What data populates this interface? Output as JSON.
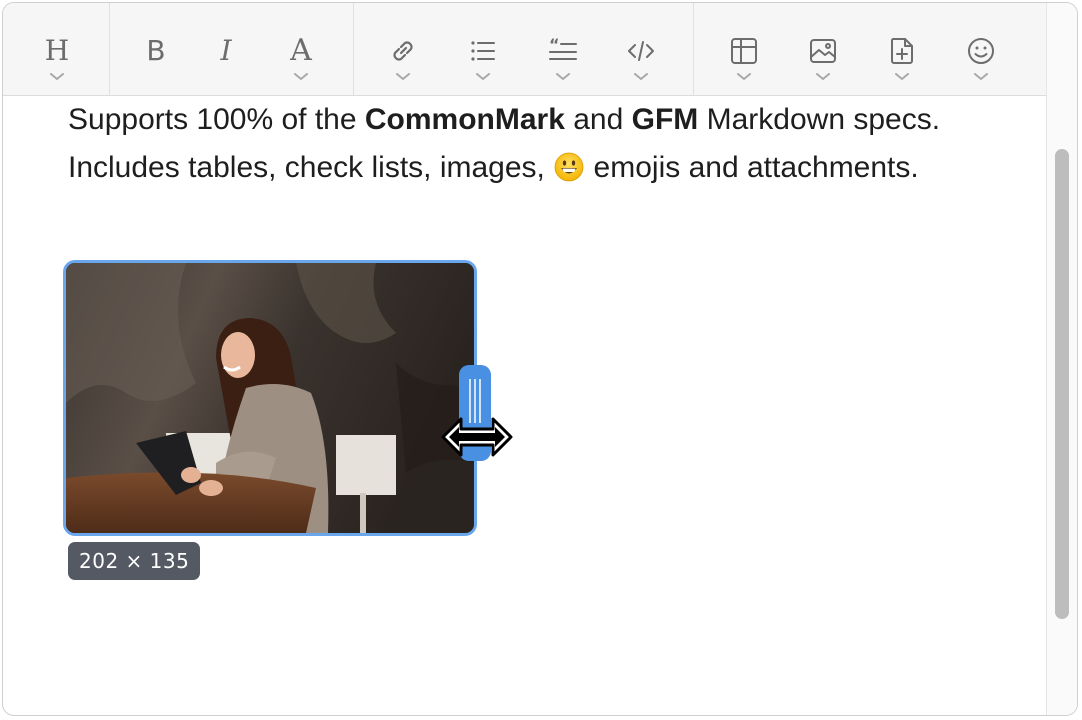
{
  "toolbar": {
    "tools": [
      {
        "name": "heading",
        "icon": "heading-icon",
        "has_menu": true
      },
      {
        "name": "bold",
        "icon": "bold-icon",
        "has_menu": false
      },
      {
        "name": "italic",
        "icon": "italic-icon",
        "has_menu": false
      },
      {
        "name": "font",
        "icon": "font-style-icon",
        "has_menu": true
      },
      {
        "name": "link",
        "icon": "link-icon",
        "has_menu": true
      },
      {
        "name": "list",
        "icon": "list-icon",
        "has_menu": true
      },
      {
        "name": "quote",
        "icon": "quote-icon",
        "has_menu": true
      },
      {
        "name": "code",
        "icon": "code-icon",
        "has_menu": true
      },
      {
        "name": "table",
        "icon": "table-icon",
        "has_menu": true
      },
      {
        "name": "image",
        "icon": "image-icon",
        "has_menu": true
      },
      {
        "name": "attachment",
        "icon": "attachment-icon",
        "has_menu": true
      },
      {
        "name": "emoji",
        "icon": "smiley-icon",
        "has_menu": true
      }
    ],
    "glyphs": {
      "heading": "H",
      "bold": "B",
      "italic": "I",
      "font": "A"
    }
  },
  "content": {
    "text_1": "Supports 100% of the ",
    "bold_1": "CommonMark",
    "text_2": " and ",
    "bold_2": "GFM",
    "text_3": " Markdown specs. Includes tables, check lists, images, ",
    "emoji_name": "grinning-face",
    "text_4": " emojis and attachments."
  },
  "image": {
    "description_icon": "photo-woman-with-tablet",
    "size_label": "202 × 135"
  },
  "colors": {
    "selection": "#6aa6ec",
    "handle": "#4a90e2",
    "badge_bg": "#555963",
    "icon": "#6d6d6d"
  }
}
